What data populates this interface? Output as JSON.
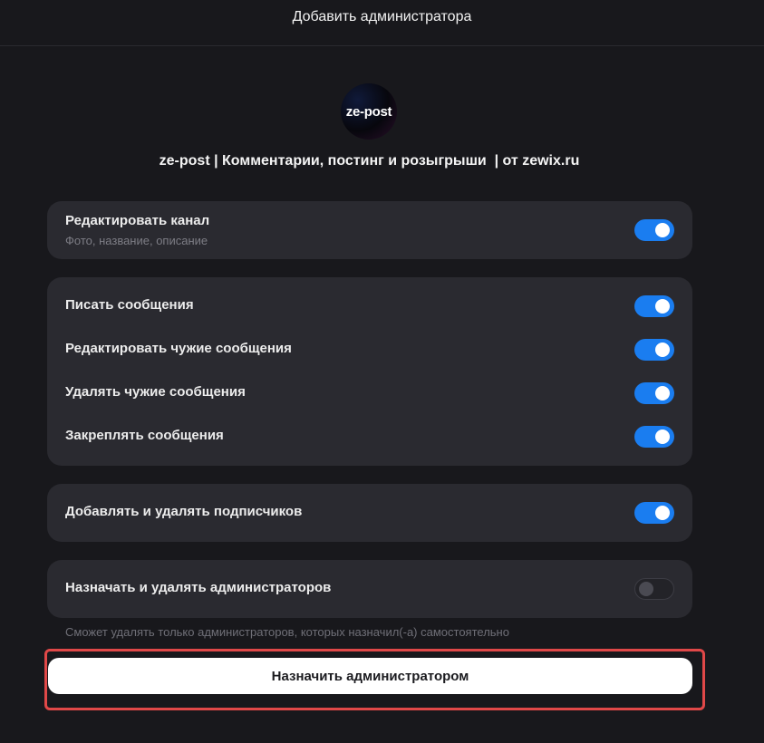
{
  "header": {
    "title": "Добавить администратора"
  },
  "channel": {
    "avatar_text": "ze-post",
    "name": "ze-post | Комментарии, постинг и розыгрыши  | от zewix.ru"
  },
  "groups": [
    {
      "rows": [
        {
          "label": "Редактировать канал",
          "sublabel": "Фото, название, описание",
          "enabled": true
        }
      ]
    },
    {
      "rows": [
        {
          "label": "Писать сообщения",
          "enabled": true
        },
        {
          "label": "Редактировать чужие сообщения",
          "enabled": true
        },
        {
          "label": "Удалять чужие сообщения",
          "enabled": true
        },
        {
          "label": "Закреплять сообщения",
          "enabled": true
        }
      ]
    },
    {
      "rows": [
        {
          "label": "Добавлять и удалять подписчиков",
          "enabled": true
        }
      ]
    },
    {
      "rows": [
        {
          "label": "Назначать и удалять администраторов",
          "enabled": false
        }
      ],
      "hint": "Сможет удалять только администраторов, которых назначил(-а) самостоятельно"
    }
  ],
  "submit": {
    "label": "Назначить администратором"
  },
  "colors": {
    "background": "#18181c",
    "card": "#2a2a30",
    "toggle_on": "#1a7df0",
    "highlight": "#e04848"
  }
}
